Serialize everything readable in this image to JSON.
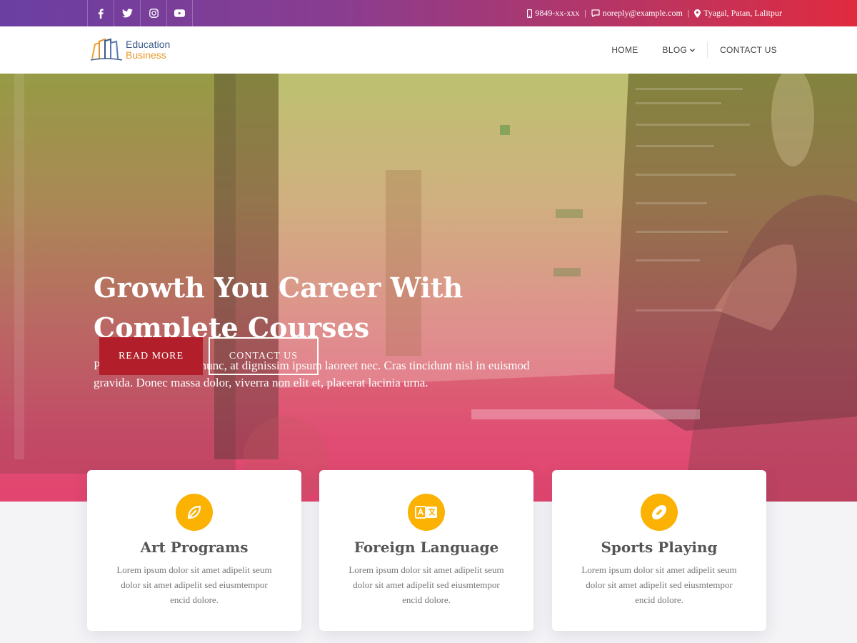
{
  "topbar": {
    "social_icons": [
      "facebook-icon",
      "twitter-icon",
      "instagram-icon",
      "youtube-icon"
    ],
    "phone": "9849-xx-xxx",
    "email": "noreply@example.com",
    "address": "Tyagal, Patan, Lalitpur",
    "separator": "|"
  },
  "header": {
    "logo_line1": "Education",
    "logo_line2": "Business",
    "nav": {
      "home": "HOME",
      "blog": "BLOG",
      "contact": "CONTACT US"
    }
  },
  "hero": {
    "title_line1": "Growth You Career With",
    "title_line2": "Complete Courses",
    "description": "Proin iaculis tristique nunc, at dignissim ipsum laoreet nec. Cras tincidunt nisl in euismod gravida. Donec massa dolor, viverra non elit et, placerat lacinia urna.",
    "read_more": "READ MORE",
    "contact_us": "CONTACT US"
  },
  "cards": [
    {
      "icon": "leaf-icon",
      "title": "Art Programs",
      "text": "Lorem ipsum dolor sit amet adipelit seum dolor sit amet adipelit sed eiusmtempor encid dolore."
    },
    {
      "icon": "translate-icon",
      "title": "Foreign Language",
      "text": "Lorem ipsum dolor sit amet adipelit seum dolor sit amet adipelit sed eiusmtempor encid dolore."
    },
    {
      "icon": "football-icon",
      "title": "Sports Playing",
      "text": "Lorem ipsum dolor sit amet adipelit seum dolor sit amet adipelit sed eiusmtempor encid dolore."
    }
  ],
  "colors": {
    "accent_yellow": "#fbb203",
    "button_red": "#b21f2a",
    "topbar_start": "#6a3fa3",
    "topbar_end": "#e02a3f"
  }
}
